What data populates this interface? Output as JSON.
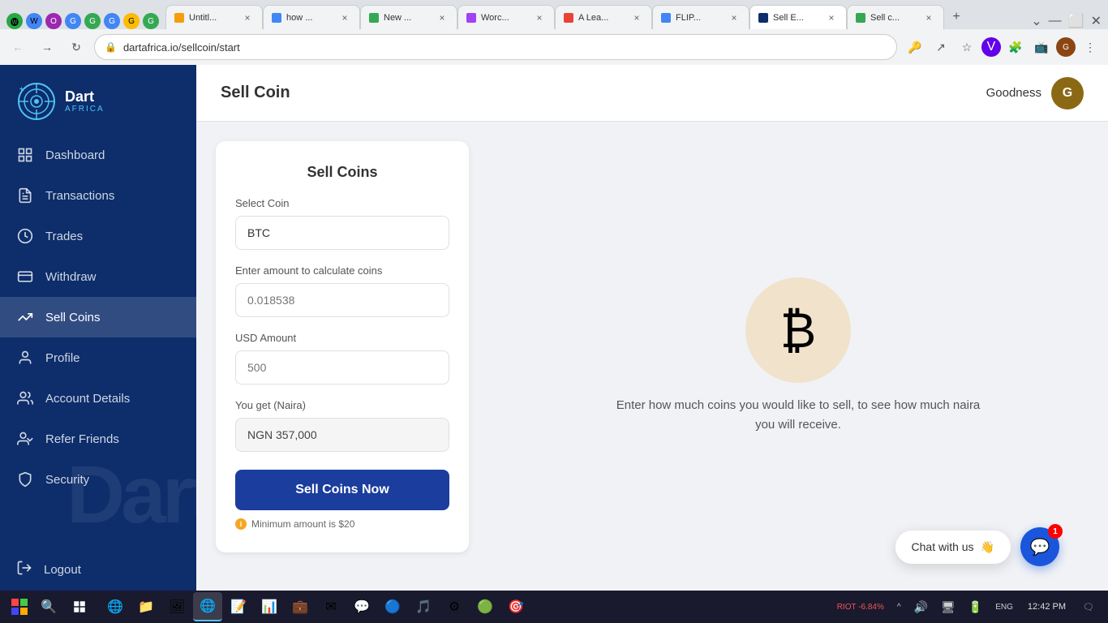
{
  "browser": {
    "url": "dartafrica.io/sellcoin/start",
    "tabs": [
      {
        "id": 1,
        "title": "Untitl...",
        "favicon_color": "#4285f4",
        "active": false
      },
      {
        "id": 2,
        "title": "how ...",
        "favicon_color": "#4285f4",
        "active": false
      },
      {
        "id": 3,
        "title": "New ...",
        "favicon_color": "#34a853",
        "active": false
      },
      {
        "id": 4,
        "title": "Worc...",
        "favicon_color": "#a142f4",
        "active": false
      },
      {
        "id": 5,
        "title": "A Lea...",
        "favicon_color": "#ea4335",
        "active": false
      },
      {
        "id": 6,
        "title": "FLIP...",
        "favicon_color": "#4285f4",
        "active": false
      },
      {
        "id": 7,
        "title": "Sell E...",
        "favicon_color": "#0d2d6b",
        "active": true
      },
      {
        "id": 8,
        "title": "Sell c...",
        "favicon_color": "#34a853",
        "active": false
      }
    ]
  },
  "page": {
    "title": "Sell Coin",
    "user": {
      "name": "Goodness",
      "avatar_initials": "G"
    }
  },
  "sidebar": {
    "logo_text": "DART\nAFRICA",
    "items": [
      {
        "id": "dashboard",
        "label": "Dashboard",
        "icon": "dashboard"
      },
      {
        "id": "transactions",
        "label": "Transactions",
        "icon": "transactions"
      },
      {
        "id": "trades",
        "label": "Trades",
        "icon": "trades"
      },
      {
        "id": "withdraw",
        "label": "Withdraw",
        "icon": "withdraw"
      },
      {
        "id": "sell-coins",
        "label": "Sell Coins",
        "icon": "sell-coins",
        "active": true
      },
      {
        "id": "profile",
        "label": "Profile",
        "icon": "profile"
      },
      {
        "id": "account-details",
        "label": "Account Details",
        "icon": "account-details"
      },
      {
        "id": "refer-friends",
        "label": "Refer Friends",
        "icon": "refer-friends"
      },
      {
        "id": "security",
        "label": "Security",
        "icon": "security"
      }
    ],
    "logout_label": "Logout"
  },
  "sell_coins": {
    "form_title": "Sell Coins",
    "select_coin_label": "Select Coin",
    "select_coin_value": "BTC",
    "amount_label": "Enter amount to calculate coins",
    "amount_placeholder": "0.018538",
    "usd_label": "USD Amount",
    "usd_placeholder": "500",
    "naira_label": "You get (Naira)",
    "naira_value": "NGN 357,000",
    "sell_btn_label": "Sell Coins Now",
    "min_amount_note": "Minimum amount is $20"
  },
  "right_panel": {
    "instruction_line1": "Enter how much coins you would like to sell, to see how much naira",
    "instruction_line2": "you will receive."
  },
  "chat": {
    "label": "Chat with us",
    "emoji": "👋",
    "badge_count": "1"
  },
  "taskbar": {
    "apps": [
      "🪟",
      "🔍",
      "🗂",
      "📁",
      "🌐",
      "📁",
      "📷",
      "📊",
      "✉",
      "📝",
      "🎵",
      "⚙",
      "🎮",
      "🎯"
    ],
    "system_items": [
      "RIOT",
      "-6.84%",
      "^",
      "🔊",
      "🖥",
      "⌨",
      "🔋"
    ],
    "time": "12:42 PM"
  }
}
